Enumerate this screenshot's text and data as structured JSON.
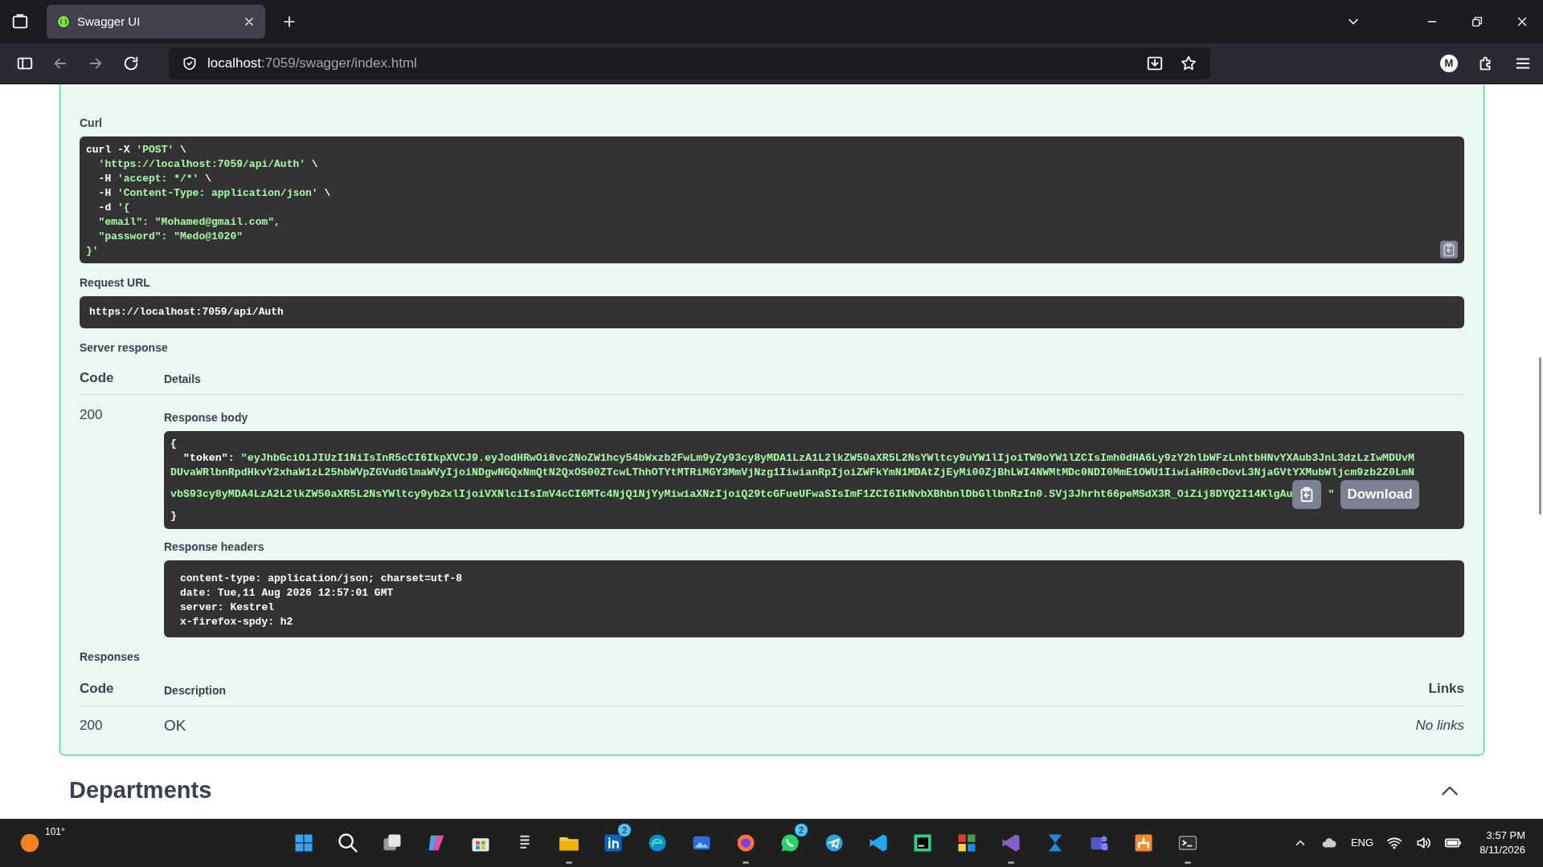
{
  "browser": {
    "tabs": [
      {
        "title": "Swagger UI",
        "selected": true
      }
    ],
    "url_host": "localhost",
    "url_path": ":7059/swagger/index.html",
    "account_initial": "M"
  },
  "curl": {
    "label": "Curl",
    "lines": [
      {
        "indented": false,
        "segments": [
          {
            "kind": "plain",
            "text": "curl -X "
          },
          {
            "kind": "string",
            "text": "'POST'"
          },
          {
            "kind": "plain",
            "text": " \\"
          }
        ]
      },
      {
        "indented": true,
        "segments": [
          {
            "kind": "string",
            "text": "'https://localhost:7059/api/Auth'"
          },
          {
            "kind": "plain",
            "text": " \\"
          }
        ]
      },
      {
        "indented": true,
        "segments": [
          {
            "kind": "plain",
            "text": "-H "
          },
          {
            "kind": "string",
            "text": "'accept: */*'"
          },
          {
            "kind": "plain",
            "text": " \\"
          }
        ]
      },
      {
        "indented": true,
        "segments": [
          {
            "kind": "plain",
            "text": "-H "
          },
          {
            "kind": "string",
            "text": "'Content-Type: application/json'"
          },
          {
            "kind": "plain",
            "text": " \\"
          }
        ]
      },
      {
        "indented": true,
        "segments": [
          {
            "kind": "plain",
            "text": "-d "
          },
          {
            "kind": "string",
            "text": "'{"
          }
        ]
      },
      {
        "indented": true,
        "segments": [
          {
            "kind": "string",
            "text": "\"email\": \"Mohamed@gmail.com\","
          }
        ]
      },
      {
        "indented": true,
        "segments": [
          {
            "kind": "string",
            "text": "\"password\": \"Medo@1020\""
          }
        ]
      },
      {
        "indented": false,
        "segments": [
          {
            "kind": "string",
            "text": "}'"
          }
        ]
      }
    ]
  },
  "request_url": {
    "label": "Request URL",
    "value": "https://localhost:7059/api/Auth"
  },
  "server_response": {
    "label": "Server response",
    "columns": [
      "Code",
      "Details"
    ],
    "code": "200",
    "body_label": "Response body",
    "body_lines": [
      {
        "indented": false,
        "segments": [
          {
            "kind": "plain",
            "text": "{"
          }
        ]
      },
      {
        "indented": true,
        "segments": [
          {
            "kind": "plain",
            "text": "\"token\": "
          },
          {
            "kind": "string",
            "text": "\"eyJhbGciOiJIUzI1NiIsInR5cCI6IkpXVCJ9.eyJodHRwOi8vc2NoZW1hcy54bWxzb2FwLm9yZy93cy8yMDA1LzA1L2lkZW50aXR5L2NsYWltcy9uYW1lIjoiTW9oYW1lZCIsImh0dHA6Ly9zY2hlbWFzLnhtbHNvYXAub3JnL3dzLzIwMDUvM"
          }
        ]
      },
      {
        "indented": false,
        "segments": [
          {
            "kind": "string",
            "text": "DUvaWRlbnRpdHkvY2xhaW1zL25hbWVpZGVudGlmaWVyIjoiNDgwNGQxNmQtN2QxOS00ZTcwLThhOTYtMTRiMGY3MmVjNzg1IiwianRpIjoiZWFkYmN1MDAtZjEyMi00ZjBhLWI4NWMtMDc0NDI0MmE1OWU1IiwiaHR0cDovL3NjaGVtYXMubWljcm9zb2Z0LmN"
          }
        ]
      },
      {
        "indented": false,
        "segments": [
          {
            "kind": "string",
            "text": "vbS93cy8yMDA4LzA2L2lkZW50aXR5L2NsYWltcy9yb2xlIjoiVXNlciIsImV4cCI6MTc4NjQ1NjYyMiwiaXNzIjoiQ29tcGFueUFwaSIsImF1ZCI6IkNvbXBhbnlDbGllbnRzIn0.SVj3Jhrht66peMSdX3R_OiZij8DYQ2I14KlgAu"
          },
          {
            "kind": "tail",
            "text": "\""
          }
        ]
      },
      {
        "indented": false,
        "segments": [
          {
            "kind": "plain",
            "text": "}"
          }
        ]
      }
    ],
    "download_label": "Download",
    "headers_label": "Response headers",
    "headers": [
      "content-type: application/json; charset=utf-8",
      "date: Tue,11 Aug 2026 12:57:01 GMT",
      "server: Kestrel",
      "x-firefox-spdy: h2"
    ]
  },
  "responses": {
    "label": "Responses",
    "columns": [
      "Code",
      "Description",
      "Links"
    ],
    "rows": [
      {
        "code": "200",
        "description": "OK",
        "links": "No links"
      }
    ]
  },
  "next_section": {
    "title": "Departments",
    "expanded": true
  },
  "taskbar": {
    "weather": "101°",
    "apps": [
      {
        "kind": "start",
        "running": false
      },
      {
        "kind": "search",
        "running": false
      },
      {
        "kind": "taskview",
        "running": false
      },
      {
        "kind": "copilot",
        "running": false
      },
      {
        "kind": "store",
        "running": false
      },
      {
        "kind": "notes",
        "running": false
      },
      {
        "kind": "folder",
        "running": true
      },
      {
        "kind": "linkedin",
        "badge": "2",
        "running": false
      },
      {
        "kind": "edge",
        "running": false
      },
      {
        "kind": "photos",
        "running": false
      },
      {
        "kind": "firefox",
        "running": true
      },
      {
        "kind": "whatsapp",
        "badge": "2",
        "running": false
      },
      {
        "kind": "telegram",
        "running": false
      },
      {
        "kind": "vscode",
        "running": false
      },
      {
        "kind": "pycharm",
        "running": false
      },
      {
        "kind": "tiles",
        "running": false
      },
      {
        "kind": "vstudio",
        "running": true
      },
      {
        "kind": "blue",
        "running": false
      },
      {
        "kind": "teams",
        "running": false
      },
      {
        "kind": "orange",
        "running": false
      },
      {
        "kind": "terminal",
        "running": true
      }
    ],
    "language": "ENG",
    "time": "3:57 PM",
    "date": "8/11/2026"
  }
}
